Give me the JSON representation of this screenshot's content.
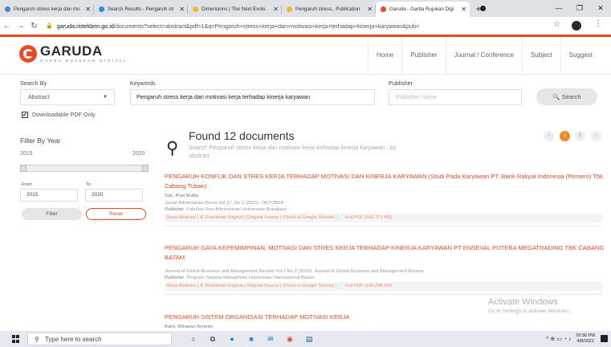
{
  "browser": {
    "tabs": [
      {
        "title": "Pengaruh stress kerja dan mo",
        "color": "#4a86c7"
      },
      {
        "title": "Search Results - Pengaruh str",
        "color": "#2f8fd0"
      },
      {
        "title": "Dimensions | The Next Evolu",
        "color": "#f2b632"
      },
      {
        "title": "Pengaruh stress.. Publication",
        "color": "#f2b632"
      },
      {
        "title": "Garuda - Garba Rujukan Digi",
        "color": "#e84b23"
      }
    ],
    "new_tab": "+",
    "url_domain": "garuda.ristekbrin.go.id",
    "url_path": "/documents?select=abstract&pdf=1&q=Pengaruh+stress+kerja+dan+motivasi+kerja+terhadap+kinerja+karyawan&pub="
  },
  "site": {
    "logo_text": "GARUDA",
    "logo_sub": "GARBA RUJUKAN DIGITAL",
    "nav": [
      "Home",
      "Publisher",
      "Journal / Conference",
      "Subject",
      "Suggest"
    ]
  },
  "search": {
    "search_by_label": "Search By",
    "search_by_value": "Abstract",
    "keywords_label": "Keywords",
    "keywords_value": "Pengaruh stress kerja dan motivasi kerja terhadap kinerja karyawan",
    "publisher_label": "Publisher",
    "publisher_placeholder": "Publisher Name",
    "search_button": "Search",
    "pdf_only_label": "Downloadable PDF Only"
  },
  "filter": {
    "title": "Filter By Year",
    "min_year": "2015",
    "max_year": "2020",
    "from_label": "From",
    "to_label": "To",
    "from_value": "2015",
    "to_value": "2020",
    "filter_button": "Filter",
    "reset_button": "Reset"
  },
  "results_header": {
    "found": "Found 12 documents",
    "subtitle": "Search Pengaruh stress kerja dan motivasi kerja terhadap kinerja karyawan , by abstract",
    "pages": [
      "‹",
      "1",
      "2",
      "›"
    ],
    "current_page": "1"
  },
  "results": [
    {
      "title": "PENGARUH KONFLIK DAN STRES KERJA TERHADAP MOTIVASI DAN KINERJA KARYAWAN (Studi Pada Karyawan PT. Bank Rakyat Indonesia (Persero) Tbk Cabang Tuban)",
      "authors": "Sari, Pepi Mulita",
      "journal": "Jurnal Administrasi Bisnis Vol 27, No 2 (2015): OKTOBER",
      "publisher_label": "Publisher",
      "publisher": "Fakultas Ilmu Administrasi Universitas Brawijaya",
      "links": "Show Abstract | ⬇ Download Original | Original Source | Check in Google Scholar | 📄 Full PDF (542.771 KB)"
    },
    {
      "title": "PENGARUH GAYA KEPEMIMPINAN, MOTIVASI DAN STRES KERJA TERHADAP KINERJA KARYAWAN PT ENSEVAL PUTERA MEGATRADING TBK CABANG BATAM",
      "authors": "",
      "journal": "Journal of Global Business and Management Review Vol 1 No 2 (2019): Journal of Global Business and Management Review",
      "publisher_label": "Publisher",
      "publisher": "Program Sarjana Manajemen Universitas Internasional Batam",
      "links": "Show Abstract | ⬇ Download Original | Original Source | Check in Google Scholar | 📄 Full PDF (196.248 KB)"
    },
    {
      "title": "PENGARUH SISTEM ORGANISASI TERHADAP MOTIVASI KERJA",
      "authors": "Baloi, Wirawan Aryanto"
    }
  ],
  "watermark": {
    "line1": "Activate Windows",
    "line2": "Go to Settings to activate Windows."
  },
  "taskbar": {
    "search_placeholder": "Type here to search",
    "time": "02:56 PM",
    "date": "4/8/2021"
  }
}
